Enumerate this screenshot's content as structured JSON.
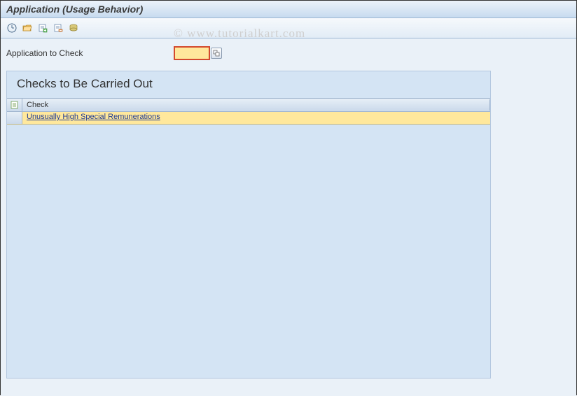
{
  "window": {
    "title": "Application (Usage Behavior)"
  },
  "toolbar": {
    "icons": {
      "execute": "execute-icon",
      "open_variant": "open-variant-icon",
      "create_header": "create-header-icon",
      "delete_header": "delete-header-icon",
      "save_variant": "save-variant-icon"
    }
  },
  "field": {
    "label": "Application to Check",
    "value": "",
    "search_help": ""
  },
  "panel": {
    "title": "Checks to Be Carried Out",
    "column_header": "Check",
    "rows": [
      {
        "text": "Unusually High Special Remunerations"
      }
    ]
  },
  "watermark": "© www.tutorialkart.com"
}
